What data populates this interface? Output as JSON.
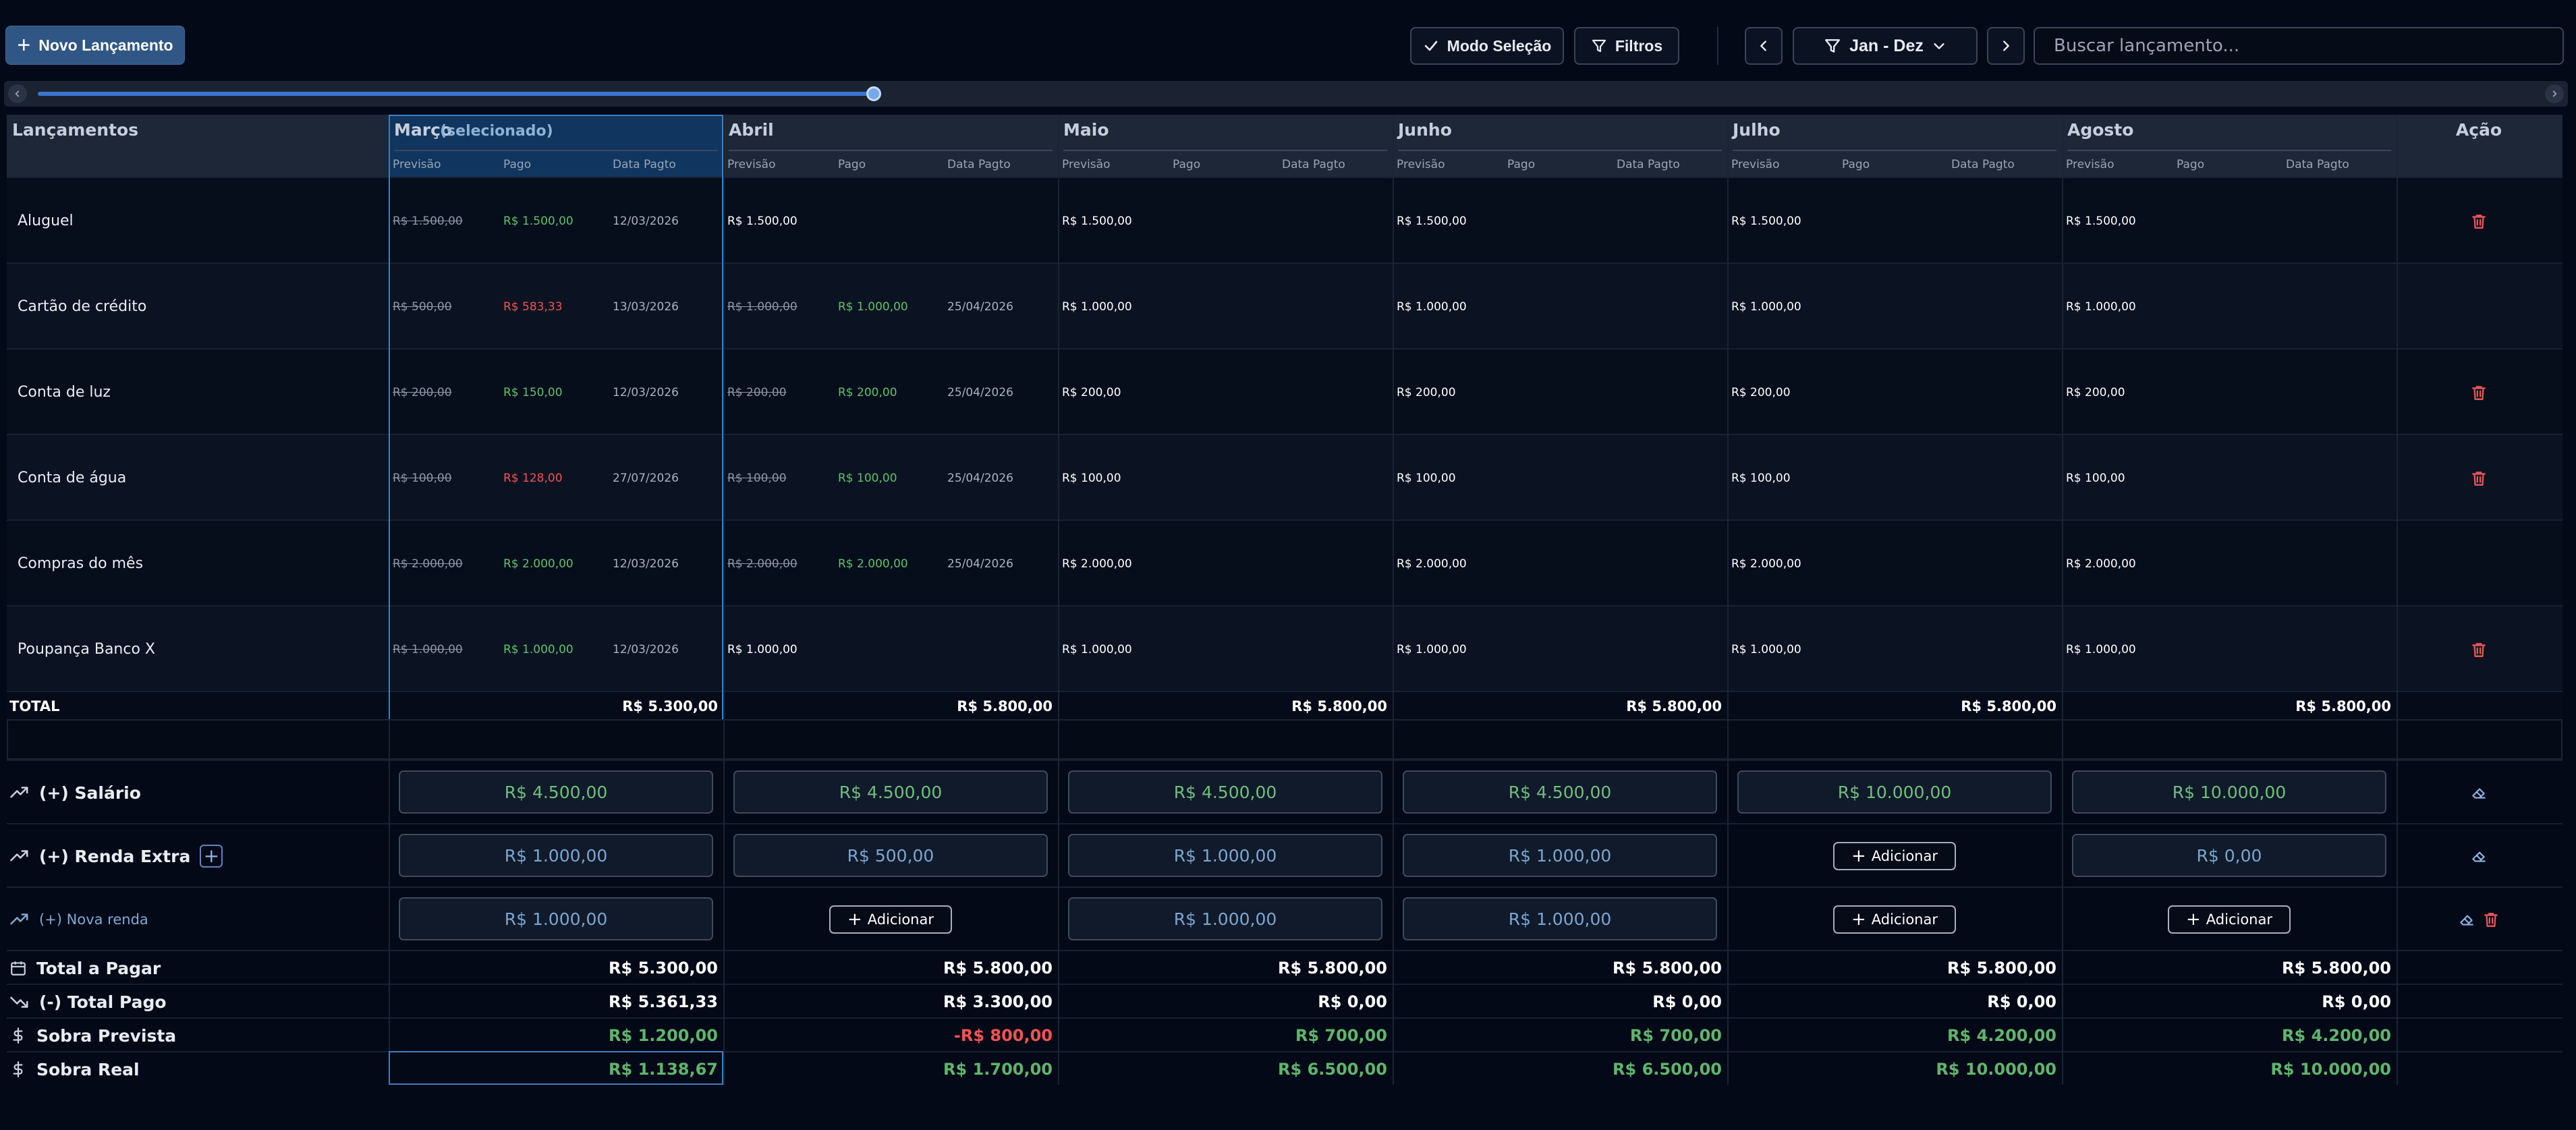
{
  "toolbar": {
    "new_entry_label": "Novo Lançamento",
    "selection_mode_label": "Modo Seleção",
    "filters_label": "Filtros",
    "period_label": "Jan - Dez",
    "search_placeholder": "Buscar lançamento..."
  },
  "table": {
    "first_col_header": "Lançamentos",
    "action_header": "Ação",
    "selected_tag": "(selecionado)",
    "sub_headers": {
      "forecast": "Previsão",
      "paid": "Pago",
      "paid_date": "Data Pagto"
    },
    "months": [
      "Março",
      "Abril",
      "Maio",
      "Junho",
      "Julho",
      "Agosto"
    ],
    "rows": [
      {
        "name": "Aluguel",
        "has_trash": true,
        "cells": [
          {
            "forecast": "R$ 1.500,00",
            "paid": "R$ 1.500,00",
            "paid_status": "ok",
            "date": "12/03/2026"
          },
          {
            "forecast": "R$ 1.500,00"
          },
          {
            "forecast": "R$ 1.500,00"
          },
          {
            "forecast": "R$ 1.500,00"
          },
          {
            "forecast": "R$ 1.500,00"
          },
          {
            "forecast": "R$ 1.500,00"
          }
        ]
      },
      {
        "name": "Cartão de crédito",
        "has_trash": false,
        "cells": [
          {
            "forecast": "R$ 500,00",
            "paid": "R$ 583,33",
            "paid_status": "over",
            "date": "13/03/2026"
          },
          {
            "forecast": "R$ 1.000,00",
            "paid": "R$ 1.000,00",
            "paid_status": "ok",
            "date": "25/04/2026"
          },
          {
            "forecast": "R$ 1.000,00"
          },
          {
            "forecast": "R$ 1.000,00"
          },
          {
            "forecast": "R$ 1.000,00"
          },
          {
            "forecast": "R$ 1.000,00"
          }
        ]
      },
      {
        "name": "Conta de luz",
        "has_trash": true,
        "cells": [
          {
            "forecast": "R$ 200,00",
            "paid": "R$ 150,00",
            "paid_status": "ok",
            "date": "12/03/2026"
          },
          {
            "forecast": "R$ 200,00",
            "paid": "R$ 200,00",
            "paid_status": "ok",
            "date": "25/04/2026"
          },
          {
            "forecast": "R$ 200,00"
          },
          {
            "forecast": "R$ 200,00"
          },
          {
            "forecast": "R$ 200,00"
          },
          {
            "forecast": "R$ 200,00"
          }
        ]
      },
      {
        "name": "Conta de água",
        "has_trash": true,
        "cells": [
          {
            "forecast": "R$ 100,00",
            "paid": "R$ 128,00",
            "paid_status": "over",
            "date": "27/07/2026"
          },
          {
            "forecast": "R$ 100,00",
            "paid": "R$ 100,00",
            "paid_status": "ok",
            "date": "25/04/2026"
          },
          {
            "forecast": "R$ 100,00"
          },
          {
            "forecast": "R$ 100,00"
          },
          {
            "forecast": "R$ 100,00"
          },
          {
            "forecast": "R$ 100,00"
          }
        ]
      },
      {
        "name": "Compras do mês",
        "has_trash": false,
        "cells": [
          {
            "forecast": "R$ 2.000,00",
            "paid": "R$ 2.000,00",
            "paid_status": "ok",
            "date": "12/03/2026"
          },
          {
            "forecast": "R$ 2.000,00",
            "paid": "R$ 2.000,00",
            "paid_status": "ok",
            "date": "25/04/2026"
          },
          {
            "forecast": "R$ 2.000,00"
          },
          {
            "forecast": "R$ 2.000,00"
          },
          {
            "forecast": "R$ 2.000,00"
          },
          {
            "forecast": "R$ 2.000,00"
          }
        ]
      },
      {
        "name": "Poupança Banco X",
        "has_trash": true,
        "cells": [
          {
            "forecast": "R$ 1.000,00",
            "paid": "R$ 1.000,00",
            "paid_status": "ok",
            "date": "12/03/2026"
          },
          {
            "forecast": "R$ 1.000,00"
          },
          {
            "forecast": "R$ 1.000,00"
          },
          {
            "forecast": "R$ 1.000,00"
          },
          {
            "forecast": "R$ 1.000,00"
          },
          {
            "forecast": "R$ 1.000,00"
          }
        ]
      }
    ],
    "total_label": "TOTAL",
    "totals": [
      "R$ 5.300,00",
      "R$ 5.800,00",
      "R$ 5.800,00",
      "R$ 5.800,00",
      "R$ 5.800,00",
      "R$ 5.800,00"
    ]
  },
  "income": {
    "add_label": "Adicionar",
    "rows": [
      {
        "label": "(+) Salário",
        "style": "main",
        "add_button": false,
        "actions": [
          "eraser"
        ],
        "values": [
          "R$ 4.500,00",
          "R$ 4.500,00",
          "R$ 4.500,00",
          "R$ 4.500,00",
          "R$ 10.000,00",
          "R$ 10.000,00"
        ],
        "tone": "g"
      },
      {
        "label": "(+) Renda Extra",
        "style": "main",
        "add_button": true,
        "actions": [
          "eraser"
        ],
        "values": [
          "R$ 1.000,00",
          "R$ 500,00",
          "R$ 1.000,00",
          "R$ 1.000,00",
          null,
          "R$ 0,00"
        ],
        "tone": "b"
      },
      {
        "label": "(+) Nova renda",
        "style": "muted",
        "add_button": false,
        "actions": [
          "eraser",
          "trash"
        ],
        "values": [
          "R$ 1.000,00",
          null,
          "R$ 1.000,00",
          "R$ 1.000,00",
          null,
          null
        ],
        "tone": "b"
      }
    ]
  },
  "summary": [
    {
      "label": "Total a Pagar",
      "icon": "calendar-icon",
      "tone": "white",
      "values": [
        "R$ 5.300,00",
        "R$ 5.800,00",
        "R$ 5.800,00",
        "R$ 5.800,00",
        "R$ 5.800,00",
        "R$ 5.800,00"
      ]
    },
    {
      "label": "(-) Total Pago",
      "icon": "trend-down-icon",
      "tone": "white",
      "values": [
        "R$ 5.361,33",
        "R$ 3.300,00",
        "R$ 0,00",
        "R$ 0,00",
        "R$ 0,00",
        "R$ 0,00"
      ]
    },
    {
      "label": "Sobra Prevista",
      "icon": "dollar-icon",
      "tone": "green",
      "values": [
        "R$ 1.200,00",
        "-R$ 800,00",
        "R$ 700,00",
        "R$ 700,00",
        "R$ 4.200,00",
        "R$ 4.200,00"
      ],
      "negative": [
        false,
        true,
        false,
        false,
        false,
        false
      ]
    },
    {
      "label": "Sobra Real",
      "icon": "dollar-icon",
      "tone": "green",
      "values": [
        "R$ 1.138,67",
        "R$ 1.700,00",
        "R$ 6.500,00",
        "R$ 6.500,00",
        "R$ 10.000,00",
        "R$ 10.000,00"
      ]
    }
  ],
  "colors": {
    "accent": "#2f5685",
    "paid_ok": "#5ec36a",
    "paid_over": "#f25353",
    "trash": "#e05555"
  }
}
